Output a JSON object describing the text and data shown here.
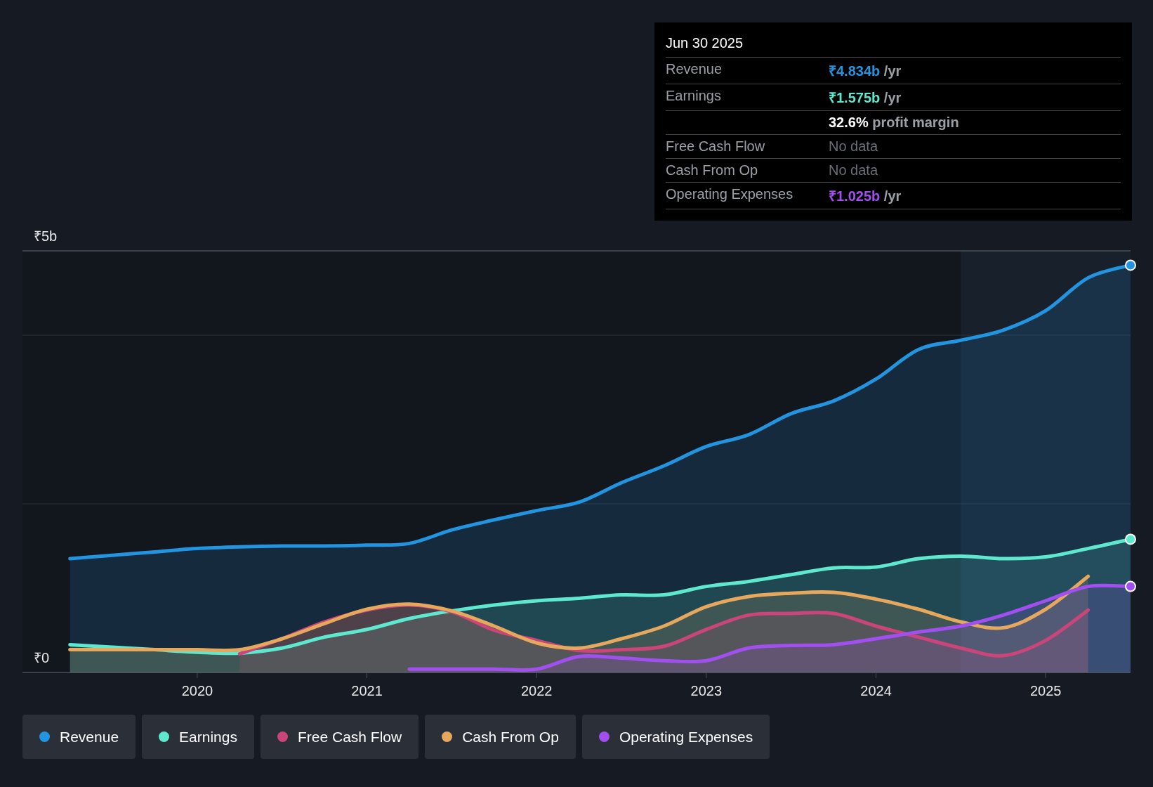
{
  "tooltip": {
    "date": "Jun 30 2025",
    "rows": [
      {
        "kind": "value",
        "label": "Revenue",
        "value": "₹4.834b",
        "unit": " /yr",
        "color": "#2394df"
      },
      {
        "kind": "value",
        "label": "Earnings",
        "value": "₹1.575b",
        "unit": " /yr",
        "color": "#5ee8d0"
      },
      {
        "kind": "margin",
        "value": "32.6%",
        "unit": " profit margin"
      },
      {
        "kind": "nodata",
        "label": "Free Cash Flow",
        "value": "No data"
      },
      {
        "kind": "nodata",
        "label": "Cash From Op",
        "value": "No data"
      },
      {
        "kind": "value",
        "label": "Operating Expenses",
        "value": "₹1.025b",
        "unit": " /yr",
        "color": "#a24ff0"
      }
    ]
  },
  "chart": {
    "chart_data": {
      "type": "area",
      "x": [
        2019.25,
        2019.5,
        2019.75,
        2020,
        2020.25,
        2020.5,
        2020.75,
        2021,
        2021.25,
        2021.5,
        2021.75,
        2022,
        2022.25,
        2022.5,
        2022.75,
        2023,
        2023.25,
        2023.5,
        2023.75,
        2024,
        2024.25,
        2024.5,
        2024.75,
        2025,
        2025.25,
        2025.5
      ],
      "series": [
        {
          "name": "Revenue",
          "color": "#2394df",
          "values": [
            1.35,
            1.39,
            1.43,
            1.47,
            1.49,
            1.5,
            1.5,
            1.51,
            1.53,
            1.69,
            1.81,
            1.92,
            2.02,
            2.25,
            2.45,
            2.68,
            2.82,
            3.07,
            3.22,
            3.48,
            3.83,
            3.94,
            4.06,
            4.29,
            4.68,
            4.83
          ]
        },
        {
          "name": "Earnings",
          "color": "#5ee8d0",
          "values": [
            0.33,
            0.3,
            0.27,
            0.24,
            0.23,
            0.29,
            0.42,
            0.51,
            0.64,
            0.73,
            0.8,
            0.85,
            0.88,
            0.92,
            0.92,
            1.02,
            1.08,
            1.16,
            1.24,
            1.25,
            1.35,
            1.38,
            1.35,
            1.37,
            1.47,
            1.58
          ]
        },
        {
          "name": "Free Cash Flow",
          "color": "#c9457a",
          "values": [
            null,
            null,
            null,
            null,
            0.22,
            0.4,
            0.6,
            0.74,
            0.8,
            0.72,
            0.5,
            0.38,
            0.26,
            0.27,
            0.31,
            0.51,
            0.68,
            0.7,
            0.7,
            0.55,
            0.42,
            0.29,
            0.2,
            0.38,
            0.74,
            null
          ]
        },
        {
          "name": "Cash From Op",
          "color": "#e6a85c",
          "values": [
            0.27,
            0.27,
            0.27,
            0.27,
            0.27,
            0.4,
            0.58,
            0.75,
            0.81,
            0.73,
            0.55,
            0.35,
            0.29,
            0.4,
            0.55,
            0.78,
            0.9,
            0.94,
            0.95,
            0.87,
            0.75,
            0.6,
            0.53,
            0.75,
            1.14,
            null
          ]
        },
        {
          "name": "Operating Expenses",
          "color": "#a24ff0",
          "values": [
            null,
            null,
            null,
            null,
            null,
            null,
            null,
            null,
            0.04,
            0.04,
            0.04,
            0.04,
            0.19,
            0.17,
            0.14,
            0.14,
            0.29,
            0.32,
            0.33,
            0.4,
            0.48,
            0.55,
            0.68,
            0.85,
            1.02,
            1.02
          ]
        }
      ],
      "xlim": [
        2018.97,
        2025.5
      ],
      "ylim": [
        0,
        5
      ],
      "yticks": [
        {
          "value": 0,
          "label": "₹0"
        },
        {
          "value": 5,
          "label": "₹5b"
        }
      ],
      "xticks": [
        {
          "value": 2020,
          "label": "2020"
        },
        {
          "value": 2021,
          "label": "2021"
        },
        {
          "value": 2022,
          "label": "2022"
        },
        {
          "value": 2023,
          "label": "2023"
        },
        {
          "value": 2024,
          "label": "2024"
        },
        {
          "value": 2025,
          "label": "2025"
        }
      ],
      "ref_lines": [
        {
          "axis": "y",
          "value": 2
        },
        {
          "axis": "y",
          "value": 4
        }
      ],
      "bands": [
        {
          "axis": "x",
          "from": 2024.5,
          "to": 2025.5
        }
      ],
      "legend": "bottom"
    }
  }
}
